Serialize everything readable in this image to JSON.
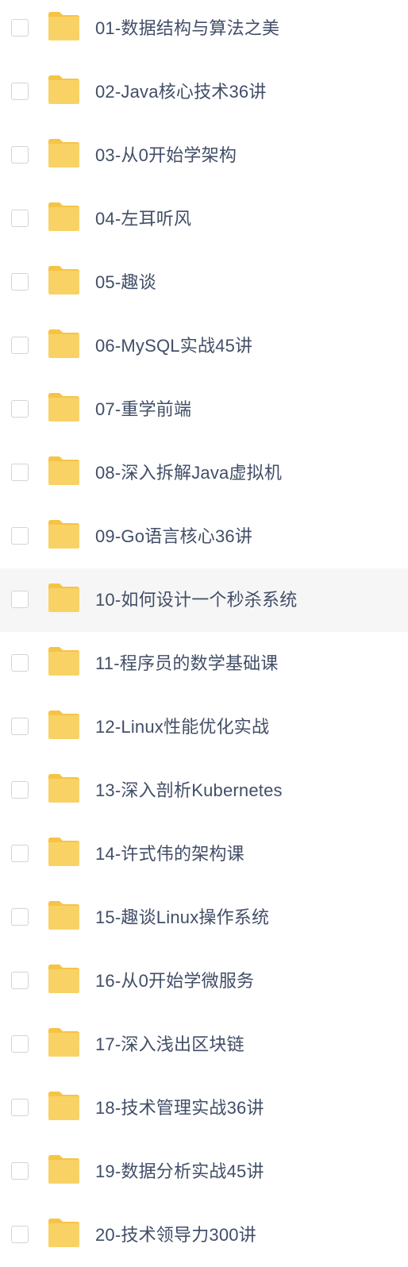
{
  "file_list": {
    "hovered_index": 9,
    "icon": "folder-icon",
    "colors": {
      "folder": "#f9d266",
      "folder_tab": "#f6c445",
      "text": "#424e67",
      "checkbox_border": "#d4d4d4",
      "hover_background": "#f6f6f6"
    },
    "items": [
      {
        "name": "01-数据结构与算法之美"
      },
      {
        "name": "02-Java核心技术36讲"
      },
      {
        "name": "03-从0开始学架构"
      },
      {
        "name": "04-左耳听风"
      },
      {
        "name": "05-趣谈"
      },
      {
        "name": "06-MySQL实战45讲"
      },
      {
        "name": "07-重学前端"
      },
      {
        "name": "08-深入拆解Java虚拟机"
      },
      {
        "name": "09-Go语言核心36讲"
      },
      {
        "name": "10-如何设计一个秒杀系统"
      },
      {
        "name": "11-程序员的数学基础课"
      },
      {
        "name": "12-Linux性能优化实战"
      },
      {
        "name": "13-深入剖析Kubernetes"
      },
      {
        "name": "14-许式伟的架构课"
      },
      {
        "name": "15-趣谈Linux操作系统"
      },
      {
        "name": "16-从0开始学微服务"
      },
      {
        "name": "17-深入浅出区块链"
      },
      {
        "name": "18-技术管理实战36讲"
      },
      {
        "name": "19-数据分析实战45讲"
      },
      {
        "name": "20-技术领导力300讲"
      }
    ]
  }
}
